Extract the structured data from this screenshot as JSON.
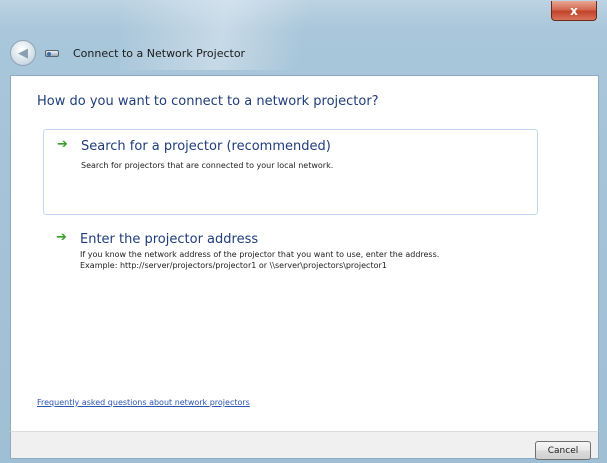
{
  "window": {
    "title": "Connect to a Network Projector",
    "close_label": "x",
    "back_glyph": "◀"
  },
  "main": {
    "heading": "How do you want to connect to a network projector?",
    "options": [
      {
        "title": "Search for a projector (recommended)",
        "description_lines": [
          "Search for projectors that are connected to your local network."
        ],
        "icon": "green-arrow-icon",
        "arrow_glyph": "➔"
      },
      {
        "title": "Enter the projector address",
        "description_lines": [
          "If you know the network address of the projector that you want to use, enter the address.",
          "Example: http://server/projectors/projector1 or \\\\server\\projectors\\projector1"
        ],
        "icon": "green-arrow-icon",
        "arrow_glyph": "➔"
      }
    ],
    "faq_link": "Frequently asked questions about network projectors"
  },
  "footer": {
    "cancel_label": "Cancel"
  },
  "colors": {
    "heading": "#1f3d7a",
    "link": "#2a55b2",
    "arrow": "#3b9d2a",
    "close_button": "#c0432a"
  }
}
